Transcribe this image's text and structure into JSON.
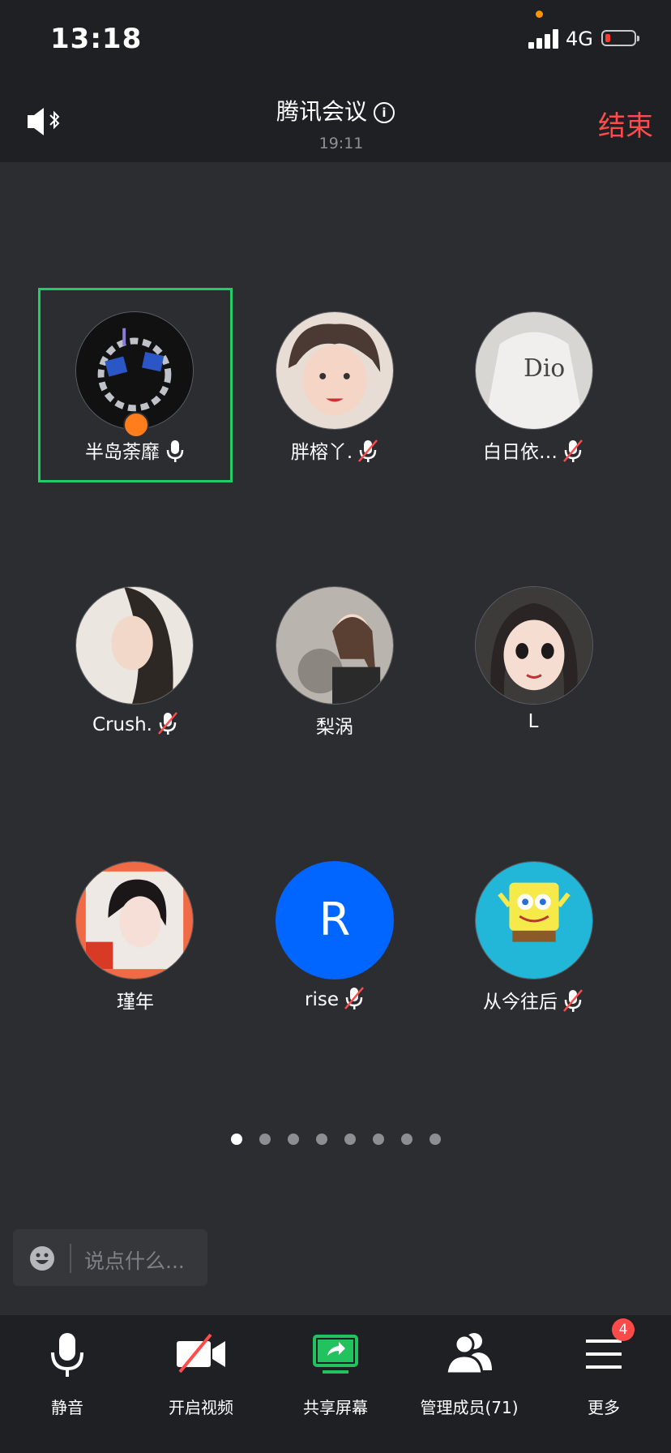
{
  "status_bar": {
    "time": "13:18",
    "network": "4G"
  },
  "header": {
    "title": "腾讯会议",
    "elapsed": "19:11",
    "end_label": "结束"
  },
  "participants": [
    {
      "name": "半岛荼靡",
      "muted": false,
      "host": true,
      "active_speaker": true
    },
    {
      "name": "胖榕丫.",
      "muted": true
    },
    {
      "name": "白日依…",
      "muted": true
    },
    {
      "name": "Crush.",
      "muted": true
    },
    {
      "name": "梨涡",
      "muted": false
    },
    {
      "name": "L",
      "muted": false
    },
    {
      "name": "瑾年",
      "muted": false
    },
    {
      "name": "rise",
      "muted": true,
      "initial": "R"
    },
    {
      "name": "从今往后",
      "muted": true
    }
  ],
  "pager": {
    "page_count": 8,
    "current_page": 1
  },
  "chat": {
    "placeholder": "说点什么..."
  },
  "toolbar": {
    "mute_label": "静音",
    "video_label": "开启视频",
    "share_label": "共享屏幕",
    "members_label": "管理成员(71)",
    "more_label": "更多",
    "more_badge": "4"
  },
  "colors": {
    "accent_green": "#1fcf63",
    "danger_red": "#ff4b4b",
    "avatar_blue": "#0066ff",
    "share_green": "#22c35e"
  }
}
